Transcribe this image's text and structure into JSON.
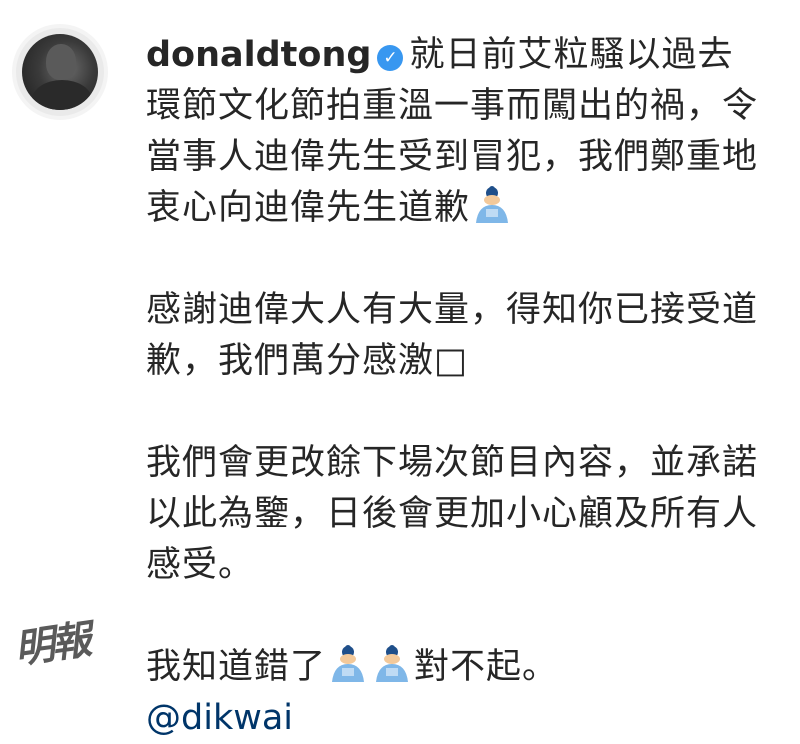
{
  "post": {
    "username": "donaldtong",
    "verified_icon": "verified-badge-icon",
    "paragraph1": "就日前艾粒騷以過去環節文化節拍重溫一事而闖出的禍，令當事人迪偉先生受到冒犯，我們鄭重地衷心向迪偉先生道歉",
    "paragraph2": "感謝迪偉大人有大量，得知你已接受道歉，我們萬分感激",
    "paragraph2_end": "□",
    "paragraph3": "我們會更改餘下場次節目內容，並承諾以此為鑒，日後會更加小心顧及所有人感受。",
    "paragraph4_prefix": "我知道錯了",
    "paragraph4_suffix": "對不起。",
    "mention": "@dikwai",
    "emoji_icon": "bowing-person-emoji-icon"
  },
  "watermark": {
    "text": "明報"
  },
  "colors": {
    "text": "#262626",
    "verified": "#3897f0",
    "mention": "#003569"
  }
}
